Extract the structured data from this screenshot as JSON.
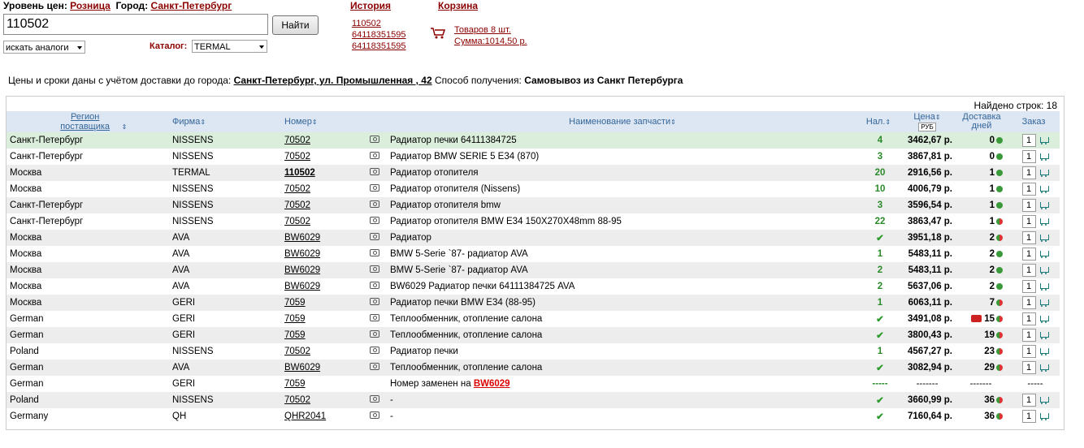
{
  "header": {
    "price_level_label": "Уровень цен:",
    "price_level_value": "Розница",
    "city_label": "Город:",
    "city_value": "Санкт-Петербург",
    "search_value": "110502",
    "find_button": "Найти",
    "analog_select": "искать аналоги",
    "catalog_label": "Каталог:",
    "catalog_value": "TERMAL",
    "history_title": "История",
    "history_items": [
      "110502",
      "64118351595",
      "64118351595"
    ],
    "cart_title": "Корзина",
    "cart_items": "Товаров 8 шт.",
    "cart_sum": "Сумма:1014,50 р."
  },
  "delivery": {
    "prefix": "Цены и сроки даны с учётом доставки до города:",
    "address": "Санкт-Петербург, ул. Промышленная , 42",
    "method_label": "Способ получения:",
    "method_value": "Самовывоз из Санкт Петербурга"
  },
  "results": {
    "found": "Найдено строк: 18",
    "headers": {
      "region": "Регион поставщика",
      "firm": "Фирма",
      "number": "Номер",
      "name": "Наименование запчасти",
      "stock": "Нал.",
      "price": "Цена",
      "currency": "РУБ",
      "delivery": "Доставка дней",
      "order": "Заказ"
    },
    "rows": [
      {
        "region": "Санкт-Петербург",
        "firm": "NISSENS",
        "number": "70502",
        "name": "Радиатор печки 64111384725",
        "stock": "4",
        "price": "3462,67 р.",
        "days": "0",
        "dot": "green"
      },
      {
        "region": "Санкт-Петербург",
        "firm": "NISSENS",
        "number": "70502",
        "name": "Радиатор BMW SERIE 5 E34 (870)",
        "stock": "3",
        "price": "3867,81 р.",
        "days": "0",
        "dot": "green"
      },
      {
        "region": "Москва",
        "firm": "TERMAL",
        "number": "110502",
        "name": "Радиатор отопителя",
        "stock": "20",
        "price": "2916,56 р.",
        "days": "1",
        "dot": "green"
      },
      {
        "region": "Москва",
        "firm": "NISSENS",
        "number": "70502",
        "name": "Радиатор отопителя (Nissens)",
        "stock": "10",
        "price": "4006,79 р.",
        "days": "1",
        "dot": "green"
      },
      {
        "region": "Санкт-Петербург",
        "firm": "NISSENS",
        "number": "70502",
        "name": "Радиатор отопителя bmw",
        "stock": "3",
        "price": "3596,54 р.",
        "days": "1",
        "dot": "green"
      },
      {
        "region": "Санкт-Петербург",
        "firm": "NISSENS",
        "number": "70502",
        "name": "Радиатор отопителя BMW E34 150X270X48mm 88-95",
        "stock": "22",
        "price": "3863,47 р.",
        "days": "1",
        "dot": "half"
      },
      {
        "region": "Москва",
        "firm": "AVA",
        "number": "BW6029",
        "name": "Радиатор",
        "stock": "✔",
        "price": "3951,18 р.",
        "days": "2",
        "dot": "half"
      },
      {
        "region": "Москва",
        "firm": "AVA",
        "number": "BW6029",
        "name": "BMW 5-Serie `87- радиатор AVA",
        "stock": "1",
        "price": "5483,11 р.",
        "days": "2",
        "dot": "green"
      },
      {
        "region": "Москва",
        "firm": "AVA",
        "number": "BW6029",
        "name": "BMW 5-Serie `87- радиатор AVA",
        "stock": "2",
        "price": "5483,11 р.",
        "days": "2",
        "dot": "green"
      },
      {
        "region": "Москва",
        "firm": "AVA",
        "number": "BW6029",
        "name": "BW6029 Радиатор печки 64111384725 AVA",
        "stock": "2",
        "price": "5637,06 р.",
        "days": "2",
        "dot": "green"
      },
      {
        "region": "Москва",
        "firm": "GERI",
        "number": "7059",
        "name": "Радиатор печки BMW E34 (88-95)",
        "stock": "1",
        "price": "6063,11 р.",
        "days": "7",
        "dot": "half"
      },
      {
        "region": "German",
        "firm": "GERI",
        "number": "7059",
        "name": "Теплообменник, отопление салона",
        "stock": "✔",
        "price": "3491,08 р.",
        "days": "15",
        "dot": "half",
        "truck": true
      },
      {
        "region": "German",
        "firm": "GERI",
        "number": "7059",
        "name": "Теплообменник, отопление салона",
        "stock": "✔",
        "price": "3800,43 р.",
        "days": "19",
        "dot": "half"
      },
      {
        "region": "Poland",
        "firm": "NISSENS",
        "number": "70502",
        "name": "Радиатор печки",
        "stock": "1",
        "price": "4567,27 р.",
        "days": "23",
        "dot": "half"
      },
      {
        "region": "German",
        "firm": "AVA",
        "number": "BW6029",
        "name": "Теплообменник, отопление салона",
        "stock": "✔",
        "price": "3082,94 р.",
        "days": "29",
        "dot": "half"
      },
      {
        "region": "German",
        "firm": "GERI",
        "number": "7059",
        "name": "Номер заменен на",
        "replaced": "BW6029",
        "stock": "-----",
        "price": "-------",
        "days": "-------",
        "order": "-----"
      },
      {
        "region": "Poland",
        "firm": "NISSENS",
        "number": "70502",
        "name": "-",
        "stock": "✔",
        "price": "3660,99 р.",
        "days": "36",
        "dot": "half"
      },
      {
        "region": "Germany",
        "firm": "QH",
        "number": "QHR2041",
        "name": "-",
        "stock": "✔",
        "price": "7160,64 р.",
        "days": "36",
        "dot": "half"
      }
    ],
    "order_qty": "1"
  }
}
